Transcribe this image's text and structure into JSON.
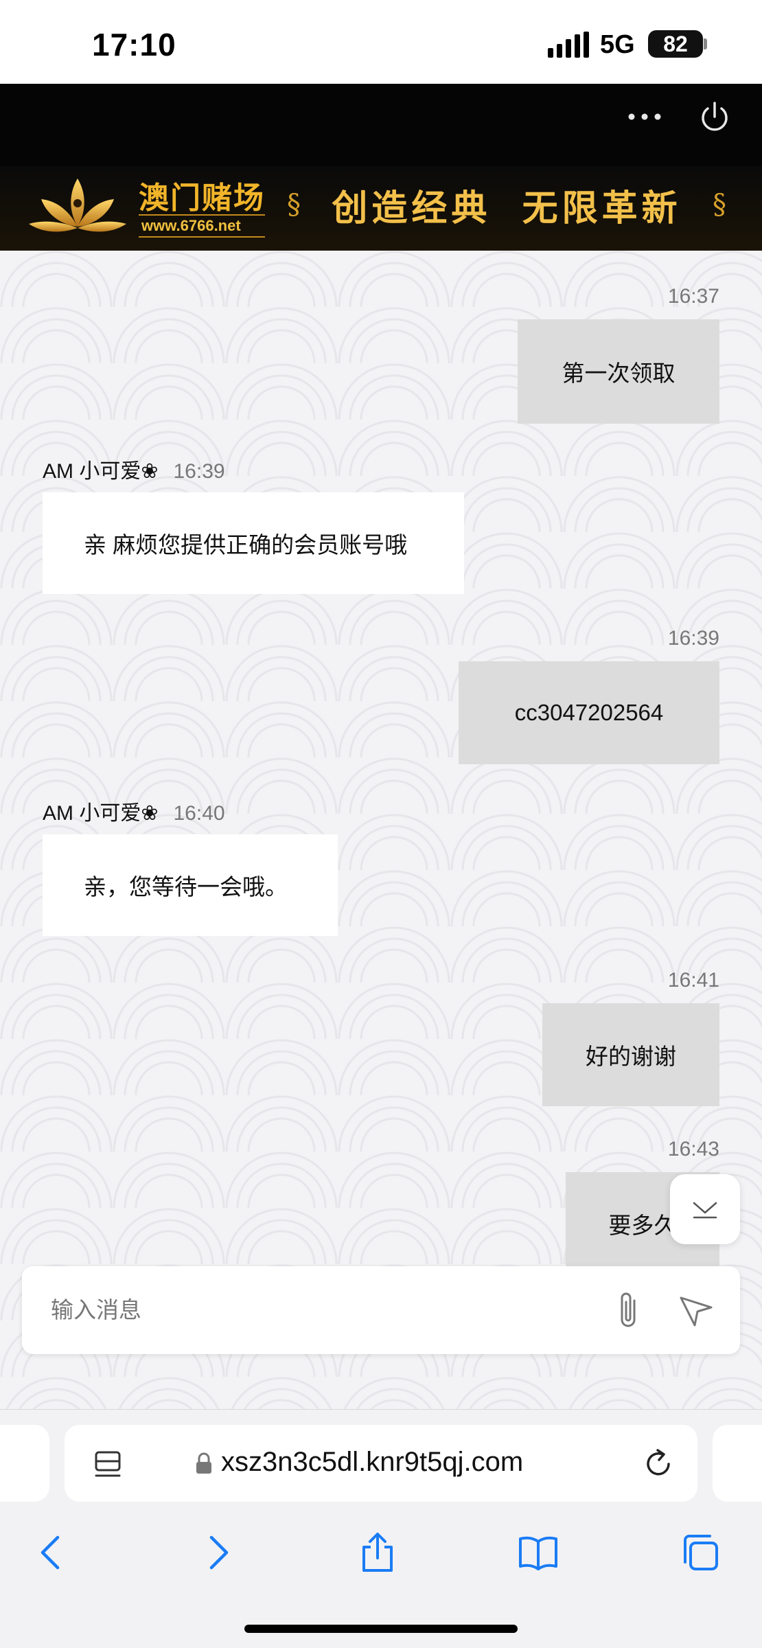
{
  "status_bar": {
    "time": "17:10",
    "network": "5G",
    "battery": "82"
  },
  "header": {
    "brand_name": "澳门赌场",
    "brand_url": "www.6766.net",
    "slogan_left": "创造经典",
    "slogan_right": "无限革新",
    "accent_color": "#f3c04a"
  },
  "chat": {
    "messages": [
      {
        "direction": "out",
        "time": "16:37",
        "text": "第一次领取"
      },
      {
        "direction": "in",
        "sender": "AM 小可爱❀",
        "time": "16:39",
        "text": "亲 麻烦您提供正确的会员账号哦"
      },
      {
        "direction": "out",
        "time": "16:39",
        "text": "cc3047202564"
      },
      {
        "direction": "in",
        "sender": "AM 小可爱❀",
        "time": "16:40",
        "text": "亲，您等待一会哦。"
      },
      {
        "direction": "out",
        "time": "16:41",
        "text": "好的谢谢"
      },
      {
        "direction": "out",
        "time": "16:43",
        "text": "要多久"
      }
    ]
  },
  "input": {
    "placeholder": "输入消息"
  },
  "browser": {
    "url": "xsz3n3c5dl.knr9t5qj.com"
  },
  "icons": [
    "signal-icon",
    "more-icon",
    "power-icon",
    "logo-icon",
    "chevron-down-icon",
    "paperclip-icon",
    "send-icon",
    "reader-icon",
    "lock-icon",
    "reload-icon",
    "back-icon",
    "forward-icon",
    "share-icon",
    "bookmarks-icon",
    "tabs-icon"
  ]
}
